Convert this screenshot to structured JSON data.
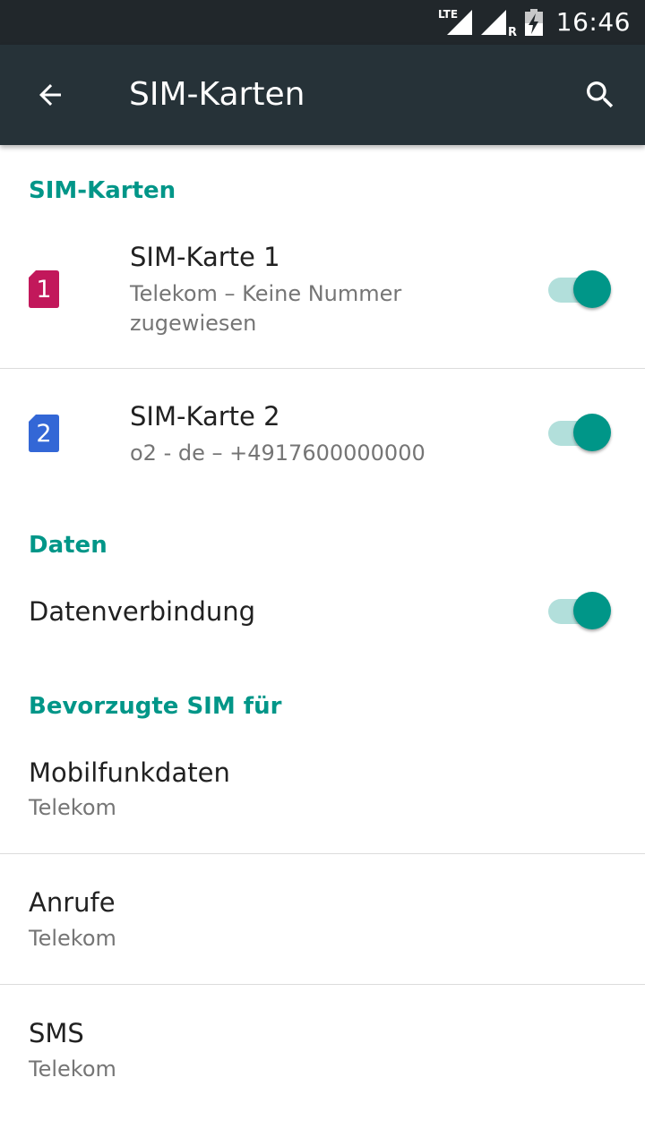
{
  "status_bar": {
    "time": "16:46",
    "network_label": "LTE",
    "roaming_label": "R",
    "icons": [
      "lte-signal-icon",
      "roaming-signal-icon",
      "battery-charging-icon"
    ]
  },
  "app_bar": {
    "title": "SIM-Karten",
    "back_icon": "arrow-back-icon",
    "search_icon": "search-icon"
  },
  "sections": {
    "sim_cards": {
      "header": "SIM-Karten",
      "items": [
        {
          "title": "SIM-Karte 1",
          "summary": "Telekom – Keine Nummer zugewiesen",
          "slot_number": "1",
          "color": "#c2185b",
          "enabled": true
        },
        {
          "title": "SIM-Karte 2",
          "summary": "o2 - de – +4917600000000",
          "slot_number": "2",
          "color": "#3367d6",
          "enabled": true
        }
      ]
    },
    "data": {
      "header": "Daten",
      "data_connection": {
        "title": "Datenverbindung",
        "enabled": true
      }
    },
    "preferred_sim": {
      "header": "Bevorzugte SIM für",
      "items": [
        {
          "title": "Mobilfunkdaten",
          "summary": "Telekom"
        },
        {
          "title": "Anrufe",
          "summary": "Telekom"
        },
        {
          "title": "SMS",
          "summary": "Telekom"
        }
      ]
    }
  },
  "colors": {
    "accent": "#009688",
    "app_bar": "#263238",
    "status_bar": "#21272b",
    "switch_track": "#b2dfdb"
  }
}
